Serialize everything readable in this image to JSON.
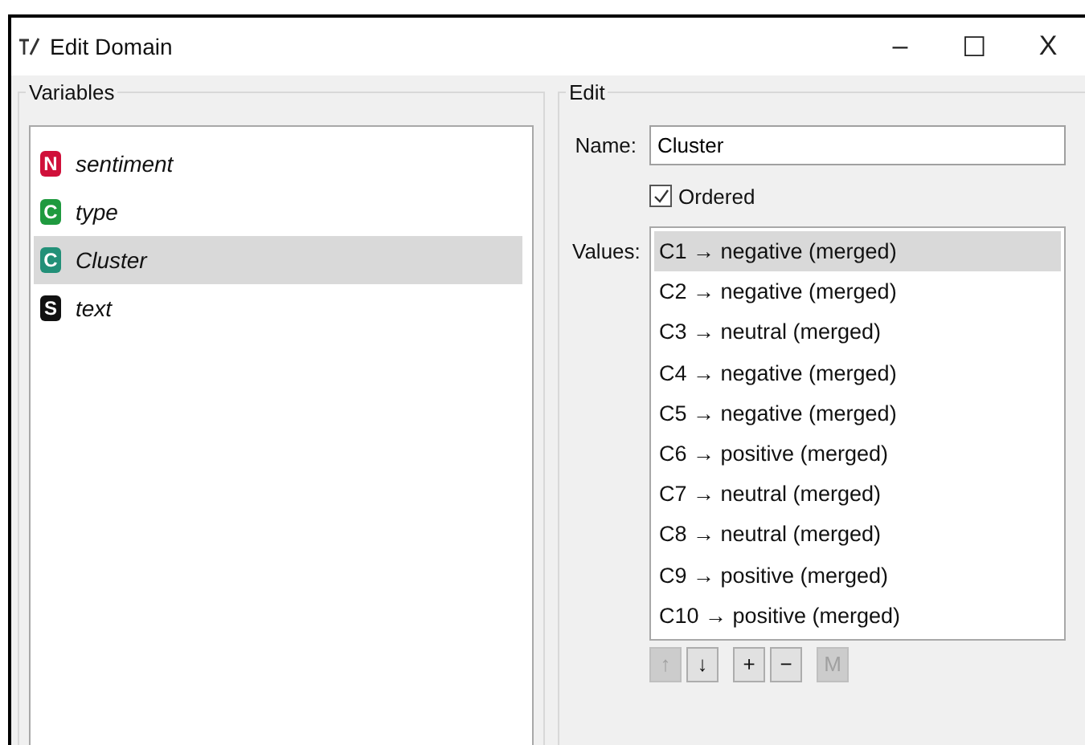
{
  "window": {
    "title": "Edit Domain",
    "controls": [
      "–",
      "☐",
      "X"
    ]
  },
  "variables": {
    "title": "Variables",
    "items": [
      {
        "badge": "N",
        "color": "#d0103a",
        "name": "sentiment",
        "selected": false
      },
      {
        "badge": "C",
        "color": "#1f9a3f",
        "name": "type",
        "selected": false
      },
      {
        "badge": "C",
        "color": "#229078",
        "name": "Cluster",
        "selected": true
      },
      {
        "badge": "S",
        "color": "#111111",
        "name": "text",
        "selected": false
      }
    ]
  },
  "edit": {
    "title": "Edit",
    "name_label": "Name:",
    "name_value": "Cluster",
    "ordered": {
      "label": "Ordered",
      "checked": true
    },
    "values_label": "Values:",
    "values": [
      {
        "text": "C1 → negative (merged)",
        "selected": true
      },
      {
        "text": "C2 → negative (merged)",
        "selected": false
      },
      {
        "text": "C3 → neutral (merged)",
        "selected": false
      },
      {
        "text": "C4 → negative (merged)",
        "selected": false
      },
      {
        "text": "C5 → negative (merged)",
        "selected": false
      },
      {
        "text": "C6 → positive (merged)",
        "selected": false
      },
      {
        "text": "C7 → neutral (merged)",
        "selected": false
      },
      {
        "text": "C8 → neutral (merged)",
        "selected": false
      },
      {
        "text": "C9 → positive (merged)",
        "selected": false
      },
      {
        "text": "C10 → positive (merged)",
        "selected": false
      }
    ],
    "buttons": [
      {
        "label": "↑",
        "disabled": true,
        "kind": "move"
      },
      {
        "label": "↓",
        "disabled": false,
        "kind": "move"
      },
      {
        "label": "+",
        "disabled": false,
        "kind": "edit"
      },
      {
        "label": "−",
        "disabled": false,
        "kind": "edit"
      },
      {
        "label": "M",
        "disabled": true,
        "kind": "merge"
      }
    ]
  }
}
